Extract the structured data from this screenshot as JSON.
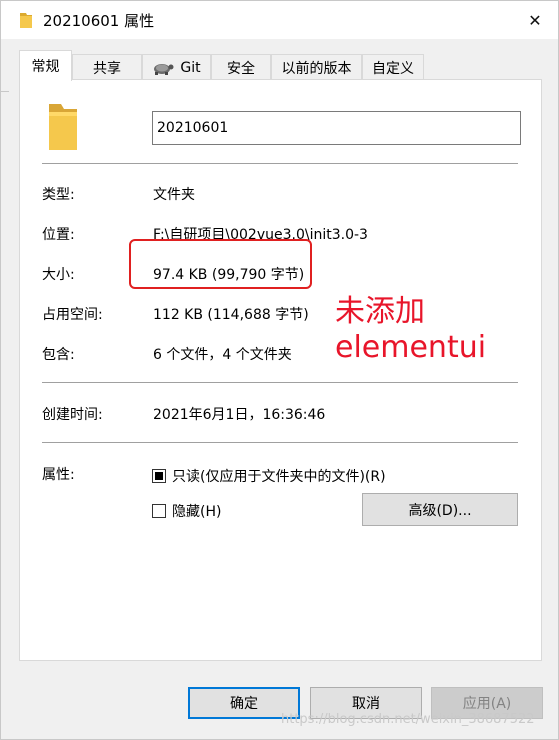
{
  "window": {
    "title": "20210601 属性",
    "close_glyph": "✕"
  },
  "tabs": [
    {
      "label": "常规",
      "active": true
    },
    {
      "label": "共享"
    },
    {
      "label": "Git"
    },
    {
      "label": "安全"
    },
    {
      "label": "以前的版本"
    },
    {
      "label": "自定义"
    }
  ],
  "general": {
    "name_value": "20210601",
    "type_label": "类型:",
    "type_value": "文件夹",
    "location_label": "位置:",
    "location_value": "F:\\自研项目\\002vue3.0\\init3.0-3",
    "size_label": "大小:",
    "size_value": "97.4 KB (99,790 字节)",
    "disk_label": "占用空间:",
    "disk_value": "112 KB (114,688 字节)",
    "contains_label": "包含:",
    "contains_value": "6 个文件，4 个文件夹",
    "created_label": "创建时间:",
    "created_value": "2021年6月1日，16:36:46",
    "attrs_label": "属性:",
    "readonly_label": "只读(仅应用于文件夹中的文件)(R)",
    "readonly_checked": true,
    "hidden_label": "隐藏(H)",
    "hidden_checked": false,
    "advanced_label": "高级(D)..."
  },
  "annotation": {
    "line1": "未添加",
    "line2": "elementui",
    "color": "#e8152a"
  },
  "buttons": {
    "ok": "确定",
    "cancel": "取消",
    "apply": "应用(A)"
  },
  "watermark": "https://blog.csdn.net/weixin_38687522",
  "icons": {
    "folder": "folder-icon",
    "git": "git-tortoise-icon",
    "close": "close-icon"
  },
  "colors": {
    "folder": "#f2c14e",
    "accent": "#0078d7"
  }
}
